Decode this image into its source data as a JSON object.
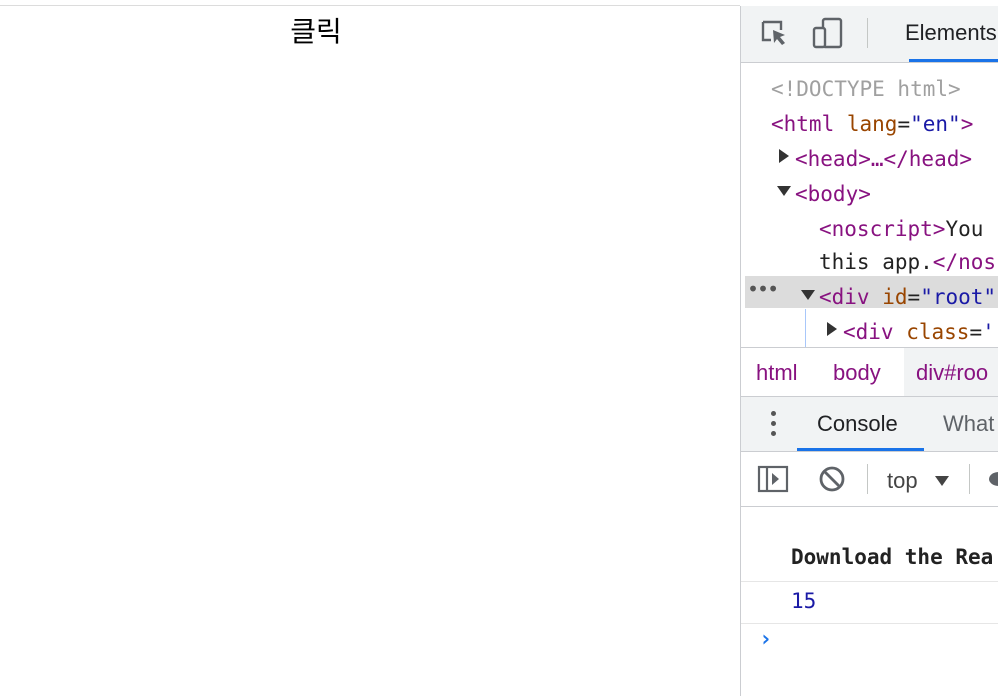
{
  "page": {
    "button_text": "클릭"
  },
  "devtools": {
    "tabs": {
      "elements": "Elements"
    },
    "dom": {
      "doctype": "<!DOCTYPE html>",
      "html_open": "<html",
      "html_attr": "lang",
      "html_eq": "=",
      "html_val": "\"en\"",
      "html_close": ">",
      "head": "<head>…</head>",
      "body": "<body>",
      "noscript_tag": "<noscript>",
      "noscript_text": "You",
      "noscript_cont": "this app.",
      "noscript_end": "</nos",
      "div_open": "<div",
      "div_attr": "id",
      "div_eq": "=",
      "div_val": "\"root\"",
      "child_open": "<div",
      "child_attr": "class",
      "child_eq": "=",
      "child_val": "'"
    },
    "breadcrumbs": [
      "html",
      "body",
      "div#roo"
    ],
    "drawer_tabs": {
      "console": "Console",
      "whats_new": "What"
    },
    "console_toolbar": {
      "context": "top"
    },
    "console": {
      "message": "Download the Rea",
      "value": "15",
      "prompt": "›"
    }
  }
}
